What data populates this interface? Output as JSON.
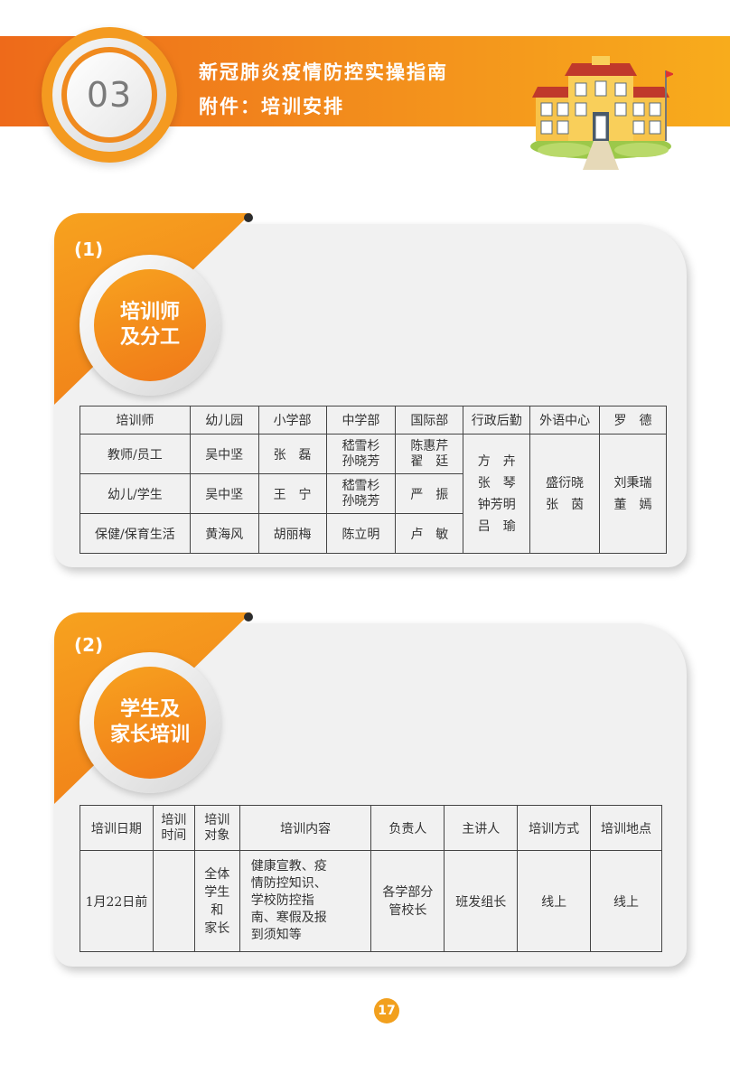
{
  "header": {
    "chapter": "03",
    "title": "新冠肺炎疫情防控实操指南",
    "subtitle": "附件：培训安排"
  },
  "section1": {
    "number": "(1)",
    "badge_line1": "培训师",
    "badge_line2": "及分工",
    "table": {
      "headers": [
        "培训师",
        "幼儿园",
        "小学部",
        "中学部",
        "国际部",
        "行政后勤",
        "外语中心",
        "罗　德"
      ],
      "rows": [
        {
          "role": "教师/员工",
          "kindergarten": "吴中坚",
          "primary": "张　磊",
          "middle_1": "嵇雪杉",
          "middle_2": "孙晓芳",
          "intl_1": "陈惠芹",
          "intl_2": "翟　廷"
        },
        {
          "role": "幼儿/学生",
          "kindergarten": "吴中坚",
          "primary": "王　宁",
          "middle_1": "嵇雪杉",
          "middle_2": "孙晓芳",
          "intl_1": "严　振"
        },
        {
          "role": "保健/保育生活",
          "kindergarten": "黄海风",
          "primary": "胡丽梅",
          "middle_1": "陈立明",
          "intl_1": "卢　敏"
        }
      ],
      "admin": [
        "方　卉",
        "张　琴",
        "钟芳明",
        "吕　瑜"
      ],
      "language_center": [
        "盛衍晓",
        "张　茵"
      ],
      "luode": [
        "刘秉瑞",
        "董　嫣"
      ]
    }
  },
  "section2": {
    "number": "(2)",
    "badge_line1": "学生及",
    "badge_line2": "家长培训",
    "table": {
      "headers": {
        "date": "培训日期",
        "time_1": "培训",
        "time_2": "时间",
        "target_1": "培训",
        "target_2": "对象",
        "content": "培训内容",
        "owner": "负责人",
        "speaker": "主讲人",
        "method": "培训方式",
        "location": "培训地点"
      },
      "row": {
        "date": "1月22日前",
        "time": "",
        "target": [
          "全体",
          "学生",
          "和",
          "家长"
        ],
        "content": [
          "健康宣教、疫",
          "情防控知识、",
          "学校防控指",
          "南、寒假及报",
          "到须知等"
        ],
        "owner": [
          "各学部分",
          "管校长"
        ],
        "speaker": "班发组长",
        "method": "线上",
        "location": "线上"
      }
    }
  },
  "page_number": "17"
}
